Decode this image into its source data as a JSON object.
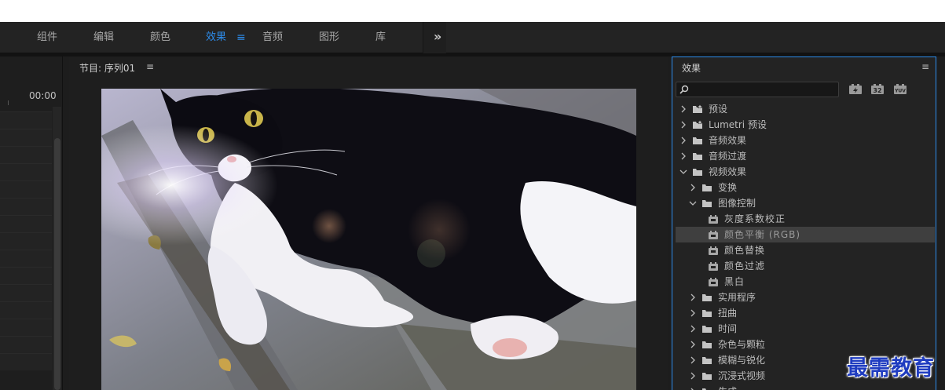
{
  "workspaces": {
    "tabs": [
      {
        "label": "组件",
        "active": false
      },
      {
        "label": "编辑",
        "active": false
      },
      {
        "label": "颜色",
        "active": false
      },
      {
        "label": "效果",
        "active": true
      },
      {
        "label": "音频",
        "active": false
      },
      {
        "label": "图形",
        "active": false
      },
      {
        "label": "库",
        "active": false
      }
    ],
    "menu_glyph": "≡",
    "more_glyph": "»"
  },
  "timeline": {
    "timecode": "00:00"
  },
  "program_monitor": {
    "title": "节目: 序列01",
    "menu_glyph": "≡"
  },
  "effects_panel": {
    "title": "效果",
    "menu_glyph": "≡",
    "search": {
      "value": "",
      "placeholder": ""
    },
    "toolbar": [
      {
        "name": "accelerated-effects-icon",
        "text": "⚡"
      },
      {
        "name": "32bit-color-icon",
        "text": "32"
      },
      {
        "name": "yuv-effects-icon",
        "text": "YUV"
      }
    ],
    "tree": [
      {
        "label": "预设",
        "level": 0,
        "type": "preset-folder",
        "expanded": false
      },
      {
        "label": "Lumetri 预设",
        "level": 0,
        "type": "preset-folder",
        "expanded": false
      },
      {
        "label": "音频效果",
        "level": 0,
        "type": "folder",
        "expanded": false
      },
      {
        "label": "音频过渡",
        "level": 0,
        "type": "folder",
        "expanded": false
      },
      {
        "label": "视频效果",
        "level": 0,
        "type": "folder",
        "expanded": true
      },
      {
        "label": "变换",
        "level": 1,
        "type": "folder",
        "expanded": false
      },
      {
        "label": "图像控制",
        "level": 1,
        "type": "folder",
        "expanded": true
      },
      {
        "label": "灰度系数校正",
        "level": 2,
        "type": "effect"
      },
      {
        "label": "颜色平衡 (RGB)",
        "level": 2,
        "type": "effect",
        "selected": true
      },
      {
        "label": "颜色替换",
        "level": 2,
        "type": "effect"
      },
      {
        "label": "颜色过滤",
        "level": 2,
        "type": "effect"
      },
      {
        "label": "黑白",
        "level": 2,
        "type": "effect"
      },
      {
        "label": "实用程序",
        "level": 1,
        "type": "folder",
        "expanded": false
      },
      {
        "label": "扭曲",
        "level": 1,
        "type": "folder",
        "expanded": false
      },
      {
        "label": "时间",
        "level": 1,
        "type": "folder",
        "expanded": false
      },
      {
        "label": "杂色与颗粒",
        "level": 1,
        "type": "folder",
        "expanded": false
      },
      {
        "label": "模糊与锐化",
        "level": 1,
        "type": "folder",
        "expanded": false
      },
      {
        "label": "沉浸式视频",
        "level": 1,
        "type": "folder",
        "expanded": false
      },
      {
        "label": "生成",
        "level": 1,
        "type": "folder",
        "expanded": false
      }
    ]
  },
  "watermark": {
    "text": "最需教育"
  },
  "colors": {
    "accent": "#2d8ceb",
    "panel_bg": "#232323",
    "selected_row": "#3f3f3f",
    "watermark": "#1f3cc0"
  }
}
